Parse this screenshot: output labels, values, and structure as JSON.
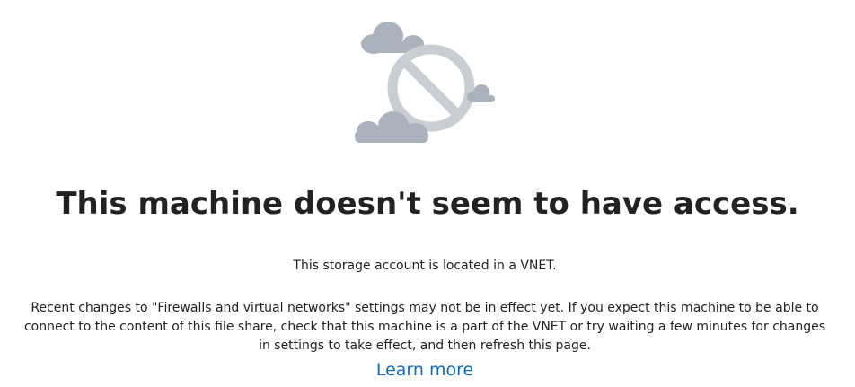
{
  "illustration": {
    "icon": "no-access-icon",
    "colors": {
      "cloud": "#aab3bd",
      "cloud_light": "#bcc4cc",
      "sign": "#c8ced4"
    }
  },
  "main": {
    "title": "This machine doesn't seem to have access.",
    "subtitle": "This storage account is located in a VNET.",
    "message": "Recent changes to \"Firewalls and virtual networks\" settings may not be in effect yet. If you expect this machine to be able to connect to the content of this file share, check that this machine is a part of the VNET or try waiting a few minutes for changes in settings to take effect, and then refresh this page.",
    "learn_more": "Learn more"
  },
  "colors": {
    "link": "#0f6cbd",
    "text": "#222222"
  }
}
